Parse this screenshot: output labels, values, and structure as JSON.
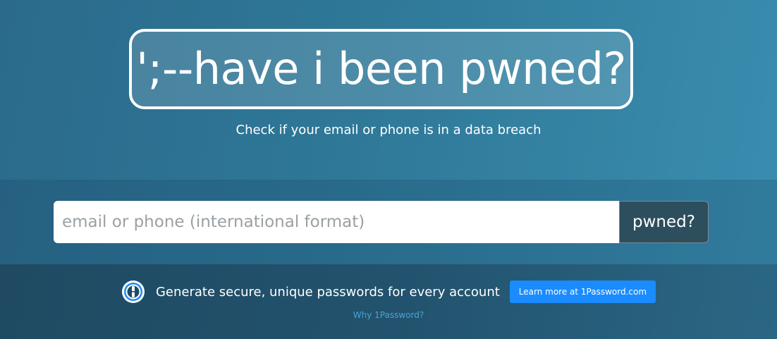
{
  "hero": {
    "logo_text": "';--have i been pwned?",
    "tagline": "Check if your email or phone is in a data breach"
  },
  "search": {
    "placeholder": "email or phone (international format)",
    "value": "",
    "button_label": "pwned?"
  },
  "promo": {
    "icon": "1password-icon",
    "text": "Generate secure, unique passwords for every account",
    "button_label": "Learn more at 1Password.com",
    "link_label": "Why 1Password?"
  },
  "colors": {
    "background": "#2f7898",
    "button_dark": "#2d4e5d",
    "promo_button": "#1a8cff",
    "link": "#4aa3d6"
  }
}
